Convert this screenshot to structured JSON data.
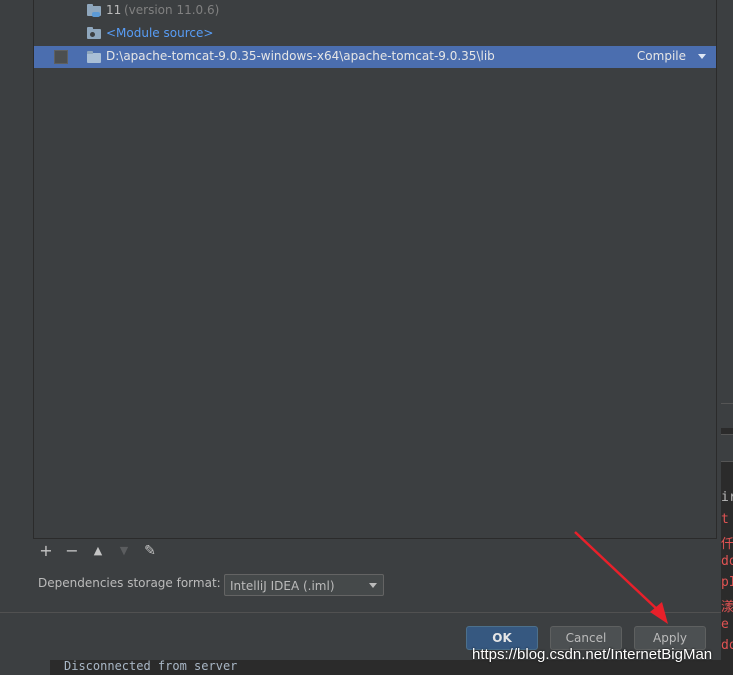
{
  "dependencies": {
    "rows": [
      {
        "name": "11",
        "extra": "(version 11.0.6)"
      },
      {
        "name": "<Module source>"
      },
      {
        "name": "D:\\apache-tomcat-9.0.35-windows-x64\\apache-tomcat-9.0.35\\lib",
        "scope": "Compile",
        "selected": true,
        "checked": false
      }
    ]
  },
  "toolbar": {
    "add": "+",
    "remove": "−",
    "up": "▲",
    "down": "▼",
    "edit": "✎"
  },
  "storage": {
    "label": "Dependencies storage format:",
    "value": "IntelliJ IDEA (.iml)"
  },
  "buttons": {
    "ok": "OK",
    "cancel": "Cancel",
    "apply": "Apply"
  },
  "console": {
    "text": "Disconnected from server"
  },
  "right_glyphs": [
    "ir",
    "t",
    "仟",
    "do",
    "pI",
    "漾",
    "e",
    "do"
  ],
  "watermark": "https://blog.csdn.net/InternetBigMan",
  "colors": {
    "selection": "#4b6eaf",
    "link": "#589df6",
    "annotation_arrow": "#e8202a",
    "console_red": "#e05353"
  }
}
